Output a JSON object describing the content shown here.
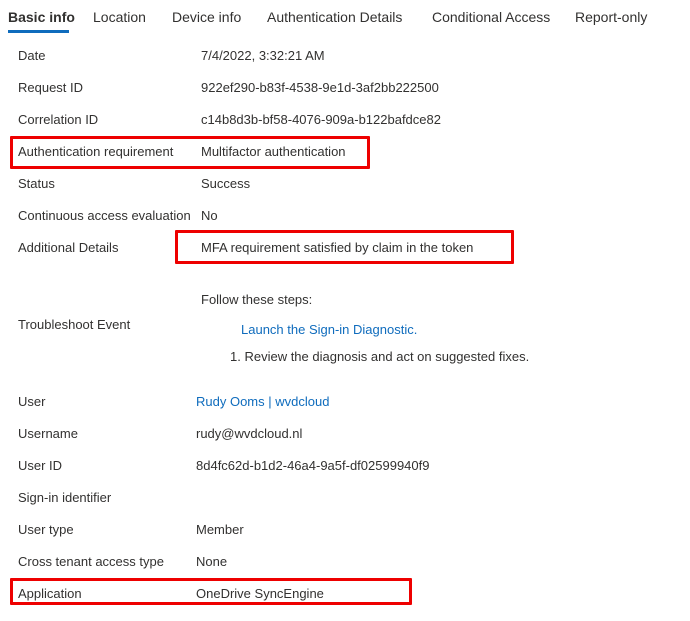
{
  "tabs": [
    {
      "label": "Basic info",
      "active": true
    },
    {
      "label": "Location",
      "active": false
    },
    {
      "label": "Device info",
      "active": false
    },
    {
      "label": "Authentication Details",
      "active": false
    },
    {
      "label": "Conditional Access",
      "active": false
    },
    {
      "label": "Report-only",
      "active": false
    }
  ],
  "details": {
    "date": {
      "label": "Date",
      "value": "7/4/2022, 3:32:21 AM"
    },
    "request_id": {
      "label": "Request ID",
      "value": "922ef290-b83f-4538-9e1d-3af2bb222500"
    },
    "correlation_id": {
      "label": "Correlation ID",
      "value": "c14b8d3b-bf58-4076-909a-b122bafdce82"
    },
    "auth_requirement": {
      "label": "Authentication requirement",
      "value": "Multifactor authentication"
    },
    "status": {
      "label": "Status",
      "value": "Success"
    },
    "cae": {
      "label": "Continuous access evaluation",
      "value": "No"
    },
    "additional_details": {
      "label": "Additional Details",
      "value": "MFA requirement satisfied by claim in the token"
    },
    "troubleshoot": {
      "label": "Troubleshoot Event",
      "intro": "Follow these steps:",
      "link": "Launch the Sign-in Diagnostic.",
      "step": "1. Review the diagnosis and act on suggested fixes."
    },
    "user": {
      "label": "User",
      "value": "Rudy Ooms | wvdcloud"
    },
    "username": {
      "label": "Username",
      "value": "rudy@wvdcloud.nl"
    },
    "user_id": {
      "label": "User ID",
      "value": "8d4fc62d-b1d2-46a4-9a5f-df02599940f9"
    },
    "signin_identifier": {
      "label": "Sign-in identifier",
      "value": ""
    },
    "user_type": {
      "label": "User type",
      "value": "Member"
    },
    "cross_tenant": {
      "label": "Cross tenant access type",
      "value": "None"
    },
    "application": {
      "label": "Application",
      "value": "OneDrive SyncEngine"
    }
  },
  "colors": {
    "accent": "#0f6cbd",
    "highlight": "#ee0000",
    "text": "#323130"
  }
}
